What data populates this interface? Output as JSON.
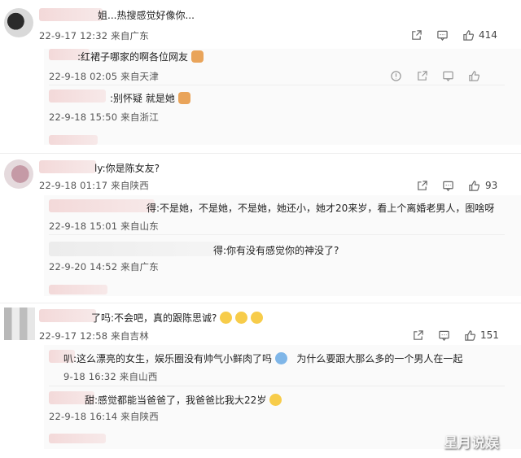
{
  "comments": [
    {
      "text": "姐...热搜感觉好像你...",
      "meta": "22-9-17 12:32 来自广东",
      "likes": "414",
      "replies": [
        {
          "text": "红裙子哪家的啊各位网友",
          "meta": "22-9-18 02:05 来自天津"
        },
        {
          "text": "别怀疑 就是她",
          "meta": "22-9-18 15:50 来自浙江"
        }
      ]
    },
    {
      "text": "你是陈女友?",
      "meta": "22-9-18 01:17 来自陕西",
      "likes": "93",
      "replies": [
        {
          "text": "不是她，不是她，不是她，她还小，她才20来岁，看上个离婚老男人，图啥呀",
          "meta": "22-9-18 15:01 来自山东"
        },
        {
          "text": "你有没有感觉你的神没了?",
          "meta": "22-9-20 14:52 来自广东"
        }
      ]
    },
    {
      "text": "不会吧，真的跟陈思诚?",
      "meta": "22-9-17 12:58 来自吉林",
      "likes": "151",
      "replies": [
        {
          "text": "这么漂亮的女生，娱乐圈没有帅气小鲜肉了吗",
          "text2": "为什么要跟大那么多的一个男人在一起",
          "meta": "9-18 16:32 来自山西"
        },
        {
          "text": "感觉都能当爸爸了，我爸爸比我大22岁",
          "meta": "22-9-18 16:14 来自陕西"
        }
      ]
    }
  ],
  "watermark": "星月说娱",
  "icons": {
    "share": "share-icon",
    "comment": "comment-icon",
    "like": "thumbs-up-icon",
    "report": "report-icon"
  }
}
